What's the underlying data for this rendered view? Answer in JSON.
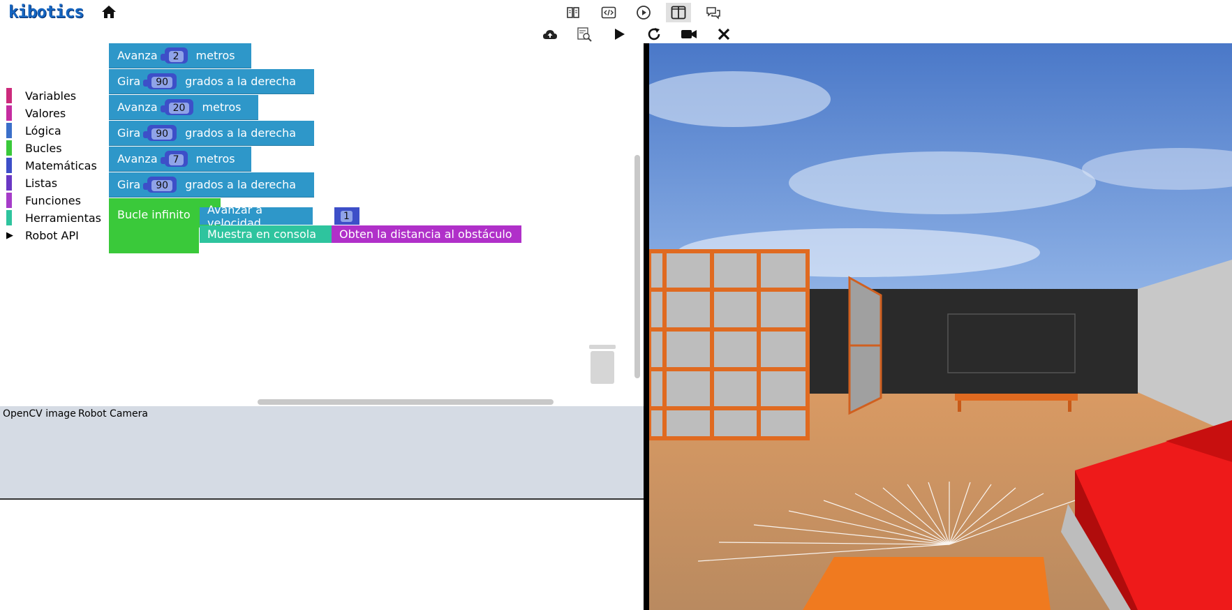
{
  "app": {
    "logo_text": "kibotics"
  },
  "topbar": {
    "icons": [
      "home-icon",
      "book-icon",
      "code-icon",
      "play-circle-icon",
      "split-view-icon",
      "chat-icon"
    ]
  },
  "toolbar": {
    "icons": [
      "cloud-upload-icon",
      "inspect-icon",
      "play-icon",
      "reload-icon",
      "camera-icon",
      "close-icon"
    ]
  },
  "toolbox": {
    "categories": [
      {
        "label": "Variables",
        "color": "#cc2a7c"
      },
      {
        "label": "Valores",
        "color": "#c52ca0"
      },
      {
        "label": "Lógica",
        "color": "#3b6fc9"
      },
      {
        "label": "Bucles",
        "color": "#3ac93a"
      },
      {
        "label": "Matemáticas",
        "color": "#3d4fc8"
      },
      {
        "label": "Listas",
        "color": "#6a37c4"
      },
      {
        "label": "Funciones",
        "color": "#a63cc9"
      },
      {
        "label": "Herramientas",
        "color": "#2ec49e"
      },
      {
        "label": "Robot API",
        "color": "#d0d0d0"
      }
    ]
  },
  "program": {
    "blocks": [
      {
        "pre": "Avanza",
        "value": "2",
        "post": "metros"
      },
      {
        "pre": "Gira",
        "value": "90",
        "post": "grados a la derecha"
      },
      {
        "pre": "Avanza",
        "value": "20",
        "post": "metros"
      },
      {
        "pre": "Gira",
        "value": "90",
        "post": "grados a la derecha"
      },
      {
        "pre": "Avanza",
        "value": "7",
        "post": "metros"
      },
      {
        "pre": "Gira",
        "value": "90",
        "post": "grados a la derecha"
      }
    ],
    "loop_label": "Bucle infinito",
    "inner": {
      "speed_label": "Avanzar a velocidad",
      "speed_value": "1",
      "print_label": "Muestra en consola",
      "distance_label": "Obten la distancia al obstáculo"
    }
  },
  "panels": {
    "opencv_label": "OpenCV image",
    "camera_label": "Robot Camera"
  },
  "colors": {
    "move_block": "#2e97c9",
    "loop_block": "#3ac93a",
    "tools_block": "#2ec49e",
    "sensor_block": "#b030c9",
    "number_block": "#3d4fc8"
  }
}
